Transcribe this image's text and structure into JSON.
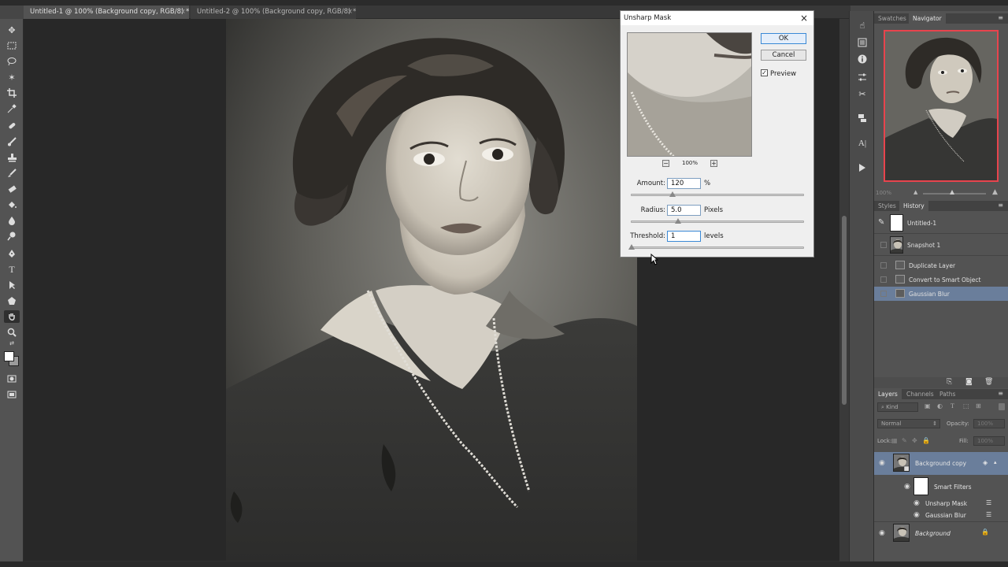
{
  "tabs": [
    {
      "label": "Untitled-1 @ 100% (Background copy, RGB/8) *",
      "close": "×"
    },
    {
      "label": "Untitled-2 @ 100% (Background copy, RGB/8) *",
      "close": "×"
    }
  ],
  "dialog": {
    "title": "Unsharp Mask",
    "close": "×",
    "ok_label": "OK",
    "cancel_label": "Cancel",
    "preview_label": "Preview",
    "preview_checked": true,
    "zoom_level": "100%",
    "zoom_minus": "−",
    "zoom_plus": "+",
    "amount": {
      "label": "Amount:",
      "value": "120",
      "unit": "%",
      "slider": 0.24
    },
    "radius": {
      "label": "Radius:",
      "value": "5.0",
      "unit": "Pixels",
      "slider": 0.27
    },
    "threshold": {
      "label": "Threshold:",
      "value": "1",
      "unit": "levels",
      "slider": 0.0
    }
  },
  "navigator": {
    "tabs": [
      "Swatches",
      "Navigator"
    ],
    "active_tab": "Navigator",
    "zoom": "100%"
  },
  "history": {
    "tabs": [
      "Styles",
      "History"
    ],
    "active_tab": "History",
    "snapshots": [
      "Untitled-1",
      "Snapshot 1"
    ],
    "items": [
      "Duplicate Layer",
      "Convert to Smart Object",
      "Gaussian Blur"
    ],
    "selected": "Gaussian Blur"
  },
  "layers": {
    "tabs": [
      "Layers",
      "Channels",
      "Paths"
    ],
    "active_tab": "Layers",
    "filter_kind": "Kind",
    "blend_mode": "Normal",
    "opacity_label": "Opacity:",
    "opacity_value": "100%",
    "lock_label": "Lock:",
    "fill_label": "Fill:",
    "fill_value": "100%",
    "items": {
      "background_copy": "Background copy",
      "smart_filters": "Smart Filters",
      "unsharp_mask": "Unsharp Mask",
      "gaussian_blur": "Gaussian Blur",
      "background": "Background"
    }
  },
  "colors": {
    "accent": "#3a89d6",
    "selection": "#6a7e9b",
    "nav_frame": "#e8444d"
  }
}
